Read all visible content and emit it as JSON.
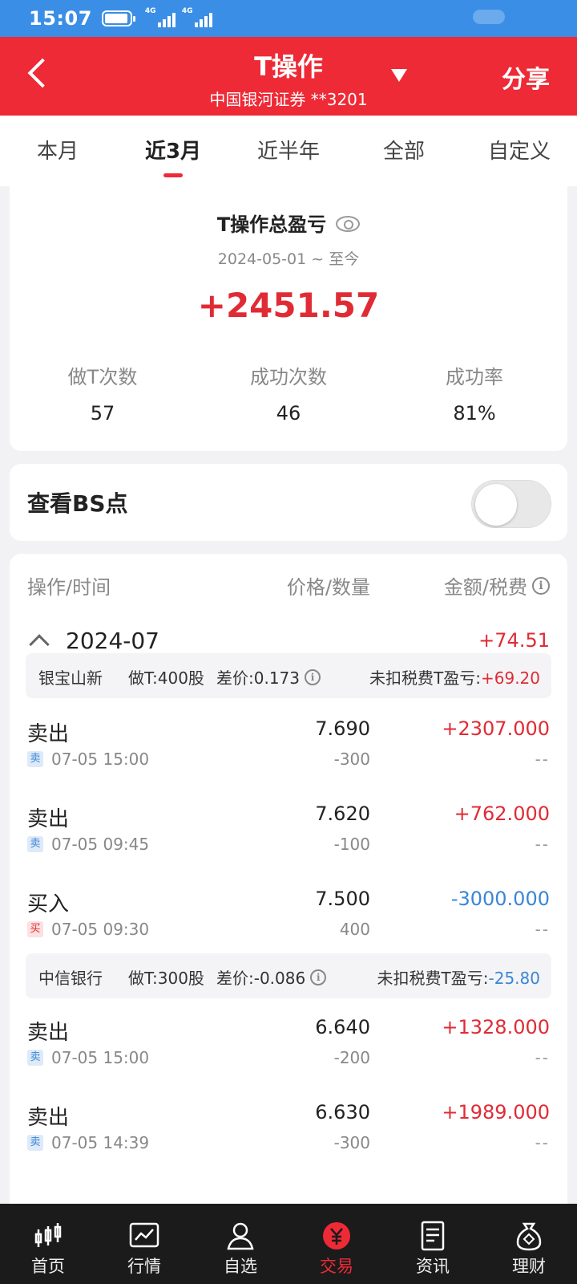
{
  "status": {
    "time": "15:07",
    "net1": "4G",
    "net2": "4G"
  },
  "header": {
    "title": "T操作",
    "subtitle": "中国银河证券 **3201",
    "share": "分享"
  },
  "tabs": [
    {
      "label": "本月"
    },
    {
      "label": "近3月"
    },
    {
      "label": "近半年"
    },
    {
      "label": "全部"
    },
    {
      "label": "自定义"
    }
  ],
  "summary": {
    "title": "T操作总盈亏",
    "range": "2024-05-01 ~ 至今",
    "value": "+2451.57",
    "stats": [
      {
        "label": "做T次数",
        "value": "57"
      },
      {
        "label": "成功次数",
        "value": "46"
      },
      {
        "label": "成功率",
        "value": "81%"
      }
    ]
  },
  "bs": {
    "label": "查看BS点"
  },
  "list": {
    "col1": "操作/时间",
    "col2": "价格/数量",
    "col3": "金额/税费",
    "month": "2024-07",
    "month_pl": "+74.51",
    "groups": [
      {
        "name": "银宝山新",
        "doT": "做T:400股",
        "diff": "差价:0.173",
        "unlabel": "未扣税费T盈亏:",
        "unvalue": "+69.20",
        "rows": [
          {
            "action": "卖出",
            "tag": "卖",
            "time": "07-05 15:00",
            "price": "7.690",
            "qty": "-300",
            "amount": "+2307.000",
            "fee": "--"
          },
          {
            "action": "卖出",
            "tag": "卖",
            "time": "07-05 09:45",
            "price": "7.620",
            "qty": "-100",
            "amount": "+762.000",
            "fee": "--"
          },
          {
            "action": "买入",
            "tag": "买",
            "time": "07-05 09:30",
            "price": "7.500",
            "qty": "400",
            "amount": "-3000.000",
            "fee": "--"
          }
        ]
      },
      {
        "name": "中信银行",
        "doT": "做T:300股",
        "diff": "差价:-0.086",
        "unlabel": "未扣税费T盈亏:",
        "unvalue": "-25.80",
        "rows": [
          {
            "action": "卖出",
            "tag": "卖",
            "time": "07-05 15:00",
            "price": "6.640",
            "qty": "-200",
            "amount": "+1328.000",
            "fee": "--"
          },
          {
            "action": "卖出",
            "tag": "卖",
            "time": "07-05 14:39",
            "price": "6.630",
            "qty": "-300",
            "amount": "+1989.000",
            "fee": "--"
          }
        ]
      }
    ]
  },
  "nav": [
    {
      "label": "首页",
      "icon": "candlestick-icon"
    },
    {
      "label": "行情",
      "icon": "chart-icon"
    },
    {
      "label": "自选",
      "icon": "user-icon"
    },
    {
      "label": "交易",
      "icon": "yuan-icon"
    },
    {
      "label": "资讯",
      "icon": "document-icon"
    },
    {
      "label": "理财",
      "icon": "money-bag-icon"
    }
  ],
  "colors": {
    "brand_red": "#ee2a36",
    "gain": "#e02b35",
    "loss": "#3a86d6",
    "status_bar": "#3a8ee6"
  }
}
